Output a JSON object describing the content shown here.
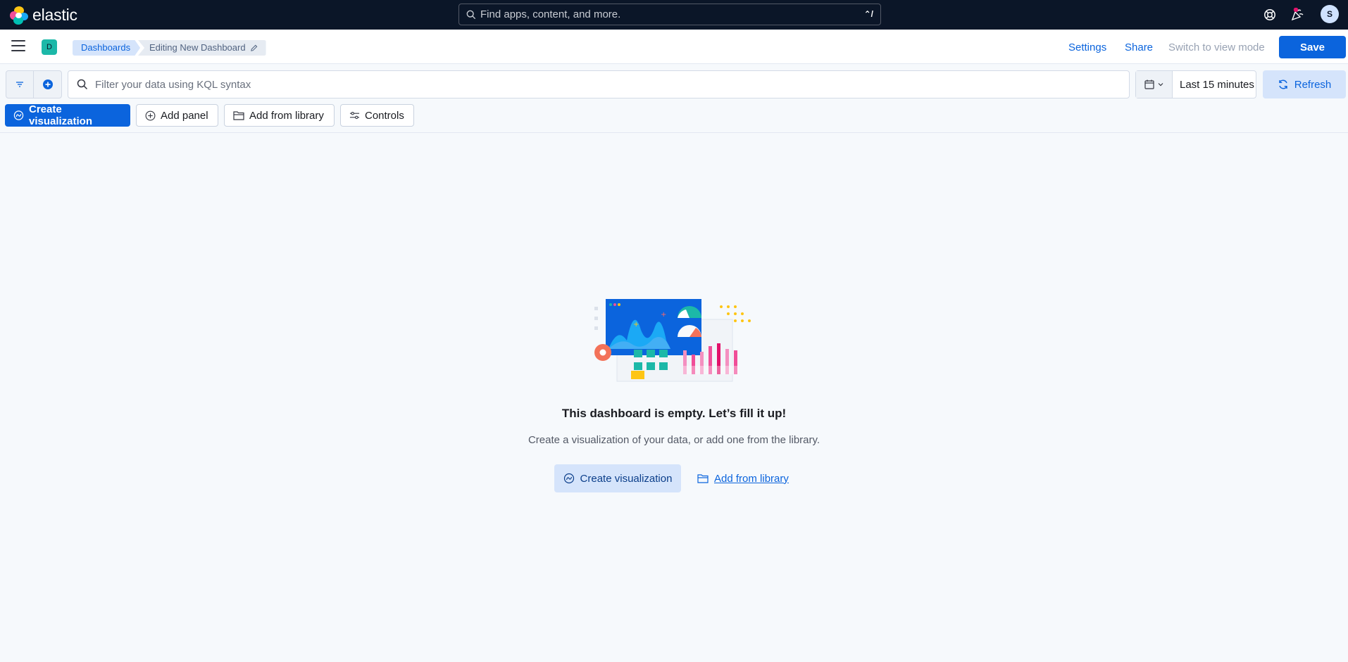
{
  "header": {
    "logo_text": "elastic",
    "search_placeholder": "Find apps, content, and more.",
    "search_shortcut": "⌃/",
    "avatar_initial": "S"
  },
  "appbar": {
    "space_initial": "D",
    "breadcrumbs": [
      "Dashboards",
      "Editing New Dashboard"
    ],
    "settings_label": "Settings",
    "share_label": "Share",
    "view_mode_label": "Switch to view mode",
    "save_label": "Save"
  },
  "query": {
    "kql_placeholder": "Filter your data using KQL syntax",
    "time_range": "Last 15 minutes",
    "refresh_label": "Refresh"
  },
  "toolbar": {
    "create_visualization": "Create visualization",
    "add_panel": "Add panel",
    "add_from_library": "Add from library",
    "controls": "Controls"
  },
  "empty_state": {
    "title": "This dashboard is empty. Let’s fill it up!",
    "description": "Create a visualization of your data, or add one from the library.",
    "create_visualization": "Create visualization",
    "add_from_library": "Add from library"
  },
  "colors": {
    "header_bg": "#0b1628",
    "primary": "#0b64dd",
    "primary_light": "#d5e4fb",
    "page_bg": "#f6f9fc"
  }
}
